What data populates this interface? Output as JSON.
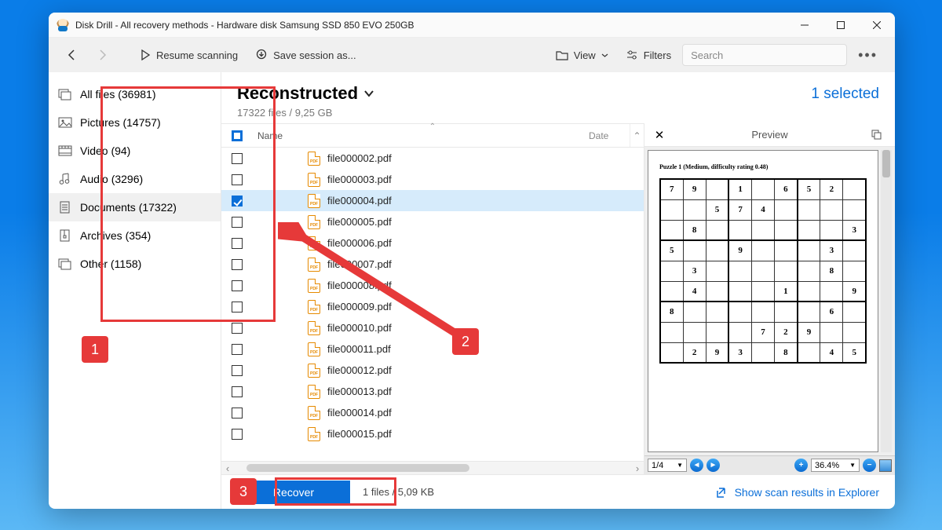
{
  "window_title": "Disk Drill - All recovery methods - Hardware disk Samsung SSD 850 EVO 250GB",
  "toolbar": {
    "resume": "Resume scanning",
    "save_session": "Save session as...",
    "view": "View",
    "filters": "Filters",
    "search_placeholder": "Search"
  },
  "sidebar": {
    "items": [
      {
        "label": "All files (36981)",
        "icon": "stack"
      },
      {
        "label": "Pictures (14757)",
        "icon": "picture"
      },
      {
        "label": "Video (94)",
        "icon": "video"
      },
      {
        "label": "Audio (3296)",
        "icon": "audio"
      },
      {
        "label": "Documents (17322)",
        "icon": "document",
        "active": true
      },
      {
        "label": "Archives (354)",
        "icon": "archive"
      },
      {
        "label": "Other (1158)",
        "icon": "other"
      }
    ]
  },
  "header": {
    "title": "Reconstructed",
    "subtitle": "17322 files / 9,25 GB",
    "selected": "1 selected"
  },
  "columns": {
    "name": "Name",
    "date": "Date"
  },
  "files": [
    {
      "name": "file000002.pdf",
      "checked": false
    },
    {
      "name": "file000003.pdf",
      "checked": false
    },
    {
      "name": "file000004.pdf",
      "checked": true,
      "selected": true
    },
    {
      "name": "file000005.pdf",
      "checked": false
    },
    {
      "name": "file000006.pdf",
      "checked": false
    },
    {
      "name": "file000007.pdf",
      "checked": false
    },
    {
      "name": "file000008.pdf",
      "checked": false
    },
    {
      "name": "file000009.pdf",
      "checked": false
    },
    {
      "name": "file000010.pdf",
      "checked": false
    },
    {
      "name": "file000011.pdf",
      "checked": false
    },
    {
      "name": "file000012.pdf",
      "checked": false
    },
    {
      "name": "file000013.pdf",
      "checked": false
    },
    {
      "name": "file000014.pdf",
      "checked": false
    },
    {
      "name": "file000015.pdf",
      "checked": false
    }
  ],
  "preview": {
    "title": "Preview",
    "doc_title": "Puzzle 1 (Medium, difficulty rating 0.48)",
    "page": "1/4",
    "zoom": "36.4%",
    "sudoku": [
      [
        "7",
        "9",
        "",
        "1",
        "",
        "6",
        "5",
        "2",
        ""
      ],
      [
        "",
        "",
        "5",
        "7",
        "4",
        "",
        "",
        "",
        ""
      ],
      [
        "",
        "8",
        "",
        "",
        "",
        "",
        "",
        "",
        "3"
      ],
      [
        "5",
        "",
        "",
        "9",
        "",
        "",
        "",
        "3",
        ""
      ],
      [
        "",
        "3",
        "",
        "",
        "",
        "",
        "",
        "8",
        ""
      ],
      [
        "",
        "4",
        "",
        "",
        "",
        "1",
        "",
        "",
        "9"
      ],
      [
        "8",
        "",
        "",
        "",
        "",
        "",
        "",
        "6",
        ""
      ],
      [
        "",
        "",
        "",
        "",
        "7",
        "2",
        "9",
        "",
        ""
      ],
      [
        "",
        "2",
        "9",
        "3",
        "",
        "8",
        "",
        "4",
        "5"
      ]
    ]
  },
  "bottombar": {
    "recover": "Recover",
    "status": "1 files / 5,09 KB",
    "explorer": "Show scan results in Explorer"
  },
  "annotations": {
    "n1": "1",
    "n2": "2",
    "n3": "3"
  }
}
